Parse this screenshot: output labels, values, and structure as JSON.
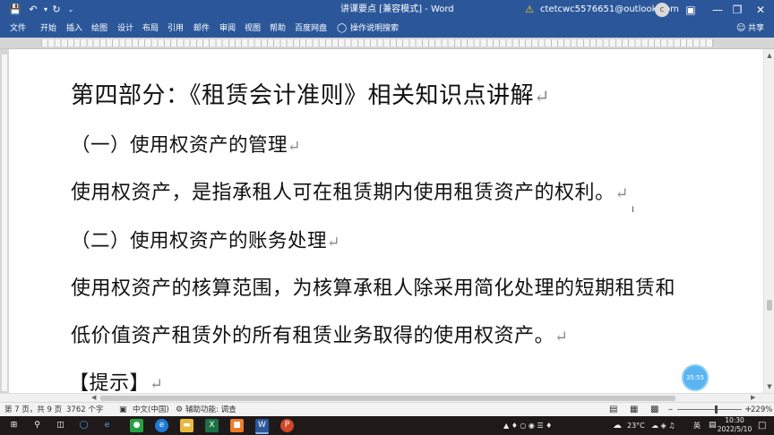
{
  "window": {
    "title": "讲课要点 [兼容模式] - Word",
    "account_email": "ctetcwc5576651@outlook.com",
    "avatar_initial": "c"
  },
  "menu": {
    "items": [
      "文件",
      "开始",
      "插入",
      "绘图",
      "设计",
      "布局",
      "引用",
      "邮件",
      "审阅",
      "视图",
      "帮助",
      "百度网盘"
    ],
    "search_label": "操作说明搜索",
    "share_label": "共享"
  },
  "document": {
    "heading": "第四部分：《租赁会计准则》相关知识点讲解",
    "sub1": "（一）使用权资产的管理",
    "para1": "使用权资产，是指承租人可在租赁期内使用租赁资产的权利。",
    "sub2": "（二）使用权资产的账务处理",
    "para2_line1": "使用权资产的核算范围，为核算承租人除采用简化处理的短期租赁和",
    "para2_line2": "低价值资产租赁外的所有租赁业务取得的使用权资产。",
    "tip": "【提示】",
    "return_mark": "↵"
  },
  "overlay": {
    "timer": "35:55"
  },
  "status": {
    "page": "第 7 页，共 9 页",
    "words": "3762 个字",
    "language": "中文(中国)",
    "accessibility": "辅助功能: 调查",
    "zoom": "229%"
  },
  "taskbar": {
    "temperature": "23°C",
    "ime": "英",
    "time": "10:30",
    "date": "2022/5/10"
  },
  "colors": {
    "word_blue": "#2b579a",
    "taskbar": "#1f1a19"
  }
}
